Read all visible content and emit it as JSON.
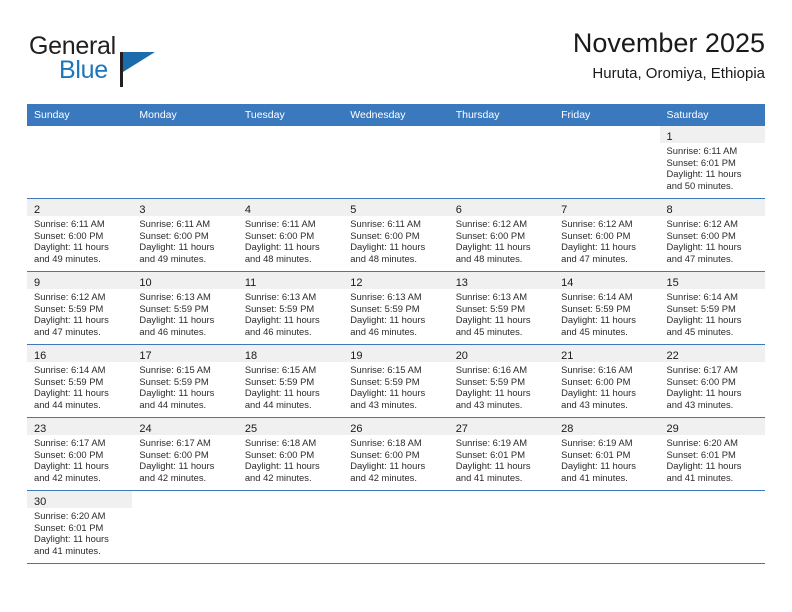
{
  "brand": {
    "name_part1": "General",
    "name_part2": "Blue",
    "logo_icon": "flag-icon"
  },
  "header": {
    "title": "November 2025",
    "location": "Huruta, Oromiya, Ethiopia"
  },
  "colors": {
    "header_blue": "#3b79bf",
    "brand_blue": "#1b76bc",
    "shade_gray": "#f0f0f0",
    "text": "#1a1a1a"
  },
  "weekdays": [
    "Sunday",
    "Monday",
    "Tuesday",
    "Wednesday",
    "Thursday",
    "Friday",
    "Saturday"
  ],
  "weeks": [
    [
      {
        "day": "",
        "lines": []
      },
      {
        "day": "",
        "lines": []
      },
      {
        "day": "",
        "lines": []
      },
      {
        "day": "",
        "lines": []
      },
      {
        "day": "",
        "lines": []
      },
      {
        "day": "",
        "lines": []
      },
      {
        "day": "1",
        "lines": [
          "Sunrise: 6:11 AM",
          "Sunset: 6:01 PM",
          "Daylight: 11 hours",
          "and 50 minutes."
        ]
      }
    ],
    [
      {
        "day": "2",
        "lines": [
          "Sunrise: 6:11 AM",
          "Sunset: 6:00 PM",
          "Daylight: 11 hours",
          "and 49 minutes."
        ]
      },
      {
        "day": "3",
        "lines": [
          "Sunrise: 6:11 AM",
          "Sunset: 6:00 PM",
          "Daylight: 11 hours",
          "and 49 minutes."
        ]
      },
      {
        "day": "4",
        "lines": [
          "Sunrise: 6:11 AM",
          "Sunset: 6:00 PM",
          "Daylight: 11 hours",
          "and 48 minutes."
        ]
      },
      {
        "day": "5",
        "lines": [
          "Sunrise: 6:11 AM",
          "Sunset: 6:00 PM",
          "Daylight: 11 hours",
          "and 48 minutes."
        ]
      },
      {
        "day": "6",
        "lines": [
          "Sunrise: 6:12 AM",
          "Sunset: 6:00 PM",
          "Daylight: 11 hours",
          "and 48 minutes."
        ]
      },
      {
        "day": "7",
        "lines": [
          "Sunrise: 6:12 AM",
          "Sunset: 6:00 PM",
          "Daylight: 11 hours",
          "and 47 minutes."
        ]
      },
      {
        "day": "8",
        "lines": [
          "Sunrise: 6:12 AM",
          "Sunset: 6:00 PM",
          "Daylight: 11 hours",
          "and 47 minutes."
        ]
      }
    ],
    [
      {
        "day": "9",
        "lines": [
          "Sunrise: 6:12 AM",
          "Sunset: 5:59 PM",
          "Daylight: 11 hours",
          "and 47 minutes."
        ]
      },
      {
        "day": "10",
        "lines": [
          "Sunrise: 6:13 AM",
          "Sunset: 5:59 PM",
          "Daylight: 11 hours",
          "and 46 minutes."
        ]
      },
      {
        "day": "11",
        "lines": [
          "Sunrise: 6:13 AM",
          "Sunset: 5:59 PM",
          "Daylight: 11 hours",
          "and 46 minutes."
        ]
      },
      {
        "day": "12",
        "lines": [
          "Sunrise: 6:13 AM",
          "Sunset: 5:59 PM",
          "Daylight: 11 hours",
          "and 46 minutes."
        ]
      },
      {
        "day": "13",
        "lines": [
          "Sunrise: 6:13 AM",
          "Sunset: 5:59 PM",
          "Daylight: 11 hours",
          "and 45 minutes."
        ]
      },
      {
        "day": "14",
        "lines": [
          "Sunrise: 6:14 AM",
          "Sunset: 5:59 PM",
          "Daylight: 11 hours",
          "and 45 minutes."
        ]
      },
      {
        "day": "15",
        "lines": [
          "Sunrise: 6:14 AM",
          "Sunset: 5:59 PM",
          "Daylight: 11 hours",
          "and 45 minutes."
        ]
      }
    ],
    [
      {
        "day": "16",
        "lines": [
          "Sunrise: 6:14 AM",
          "Sunset: 5:59 PM",
          "Daylight: 11 hours",
          "and 44 minutes."
        ]
      },
      {
        "day": "17",
        "lines": [
          "Sunrise: 6:15 AM",
          "Sunset: 5:59 PM",
          "Daylight: 11 hours",
          "and 44 minutes."
        ]
      },
      {
        "day": "18",
        "lines": [
          "Sunrise: 6:15 AM",
          "Sunset: 5:59 PM",
          "Daylight: 11 hours",
          "and 44 minutes."
        ]
      },
      {
        "day": "19",
        "lines": [
          "Sunrise: 6:15 AM",
          "Sunset: 5:59 PM",
          "Daylight: 11 hours",
          "and 43 minutes."
        ]
      },
      {
        "day": "20",
        "lines": [
          "Sunrise: 6:16 AM",
          "Sunset: 5:59 PM",
          "Daylight: 11 hours",
          "and 43 minutes."
        ]
      },
      {
        "day": "21",
        "lines": [
          "Sunrise: 6:16 AM",
          "Sunset: 6:00 PM",
          "Daylight: 11 hours",
          "and 43 minutes."
        ]
      },
      {
        "day": "22",
        "lines": [
          "Sunrise: 6:17 AM",
          "Sunset: 6:00 PM",
          "Daylight: 11 hours",
          "and 43 minutes."
        ]
      }
    ],
    [
      {
        "day": "23",
        "lines": [
          "Sunrise: 6:17 AM",
          "Sunset: 6:00 PM",
          "Daylight: 11 hours",
          "and 42 minutes."
        ]
      },
      {
        "day": "24",
        "lines": [
          "Sunrise: 6:17 AM",
          "Sunset: 6:00 PM",
          "Daylight: 11 hours",
          "and 42 minutes."
        ]
      },
      {
        "day": "25",
        "lines": [
          "Sunrise: 6:18 AM",
          "Sunset: 6:00 PM",
          "Daylight: 11 hours",
          "and 42 minutes."
        ]
      },
      {
        "day": "26",
        "lines": [
          "Sunrise: 6:18 AM",
          "Sunset: 6:00 PM",
          "Daylight: 11 hours",
          "and 42 minutes."
        ]
      },
      {
        "day": "27",
        "lines": [
          "Sunrise: 6:19 AM",
          "Sunset: 6:01 PM",
          "Daylight: 11 hours",
          "and 41 minutes."
        ]
      },
      {
        "day": "28",
        "lines": [
          "Sunrise: 6:19 AM",
          "Sunset: 6:01 PM",
          "Daylight: 11 hours",
          "and 41 minutes."
        ]
      },
      {
        "day": "29",
        "lines": [
          "Sunrise: 6:20 AM",
          "Sunset: 6:01 PM",
          "Daylight: 11 hours",
          "and 41 minutes."
        ]
      }
    ],
    [
      {
        "day": "30",
        "lines": [
          "Sunrise: 6:20 AM",
          "Sunset: 6:01 PM",
          "Daylight: 11 hours",
          "and 41 minutes."
        ]
      },
      {
        "day": "",
        "lines": []
      },
      {
        "day": "",
        "lines": []
      },
      {
        "day": "",
        "lines": []
      },
      {
        "day": "",
        "lines": []
      },
      {
        "day": "",
        "lines": []
      },
      {
        "day": "",
        "lines": []
      }
    ]
  ]
}
